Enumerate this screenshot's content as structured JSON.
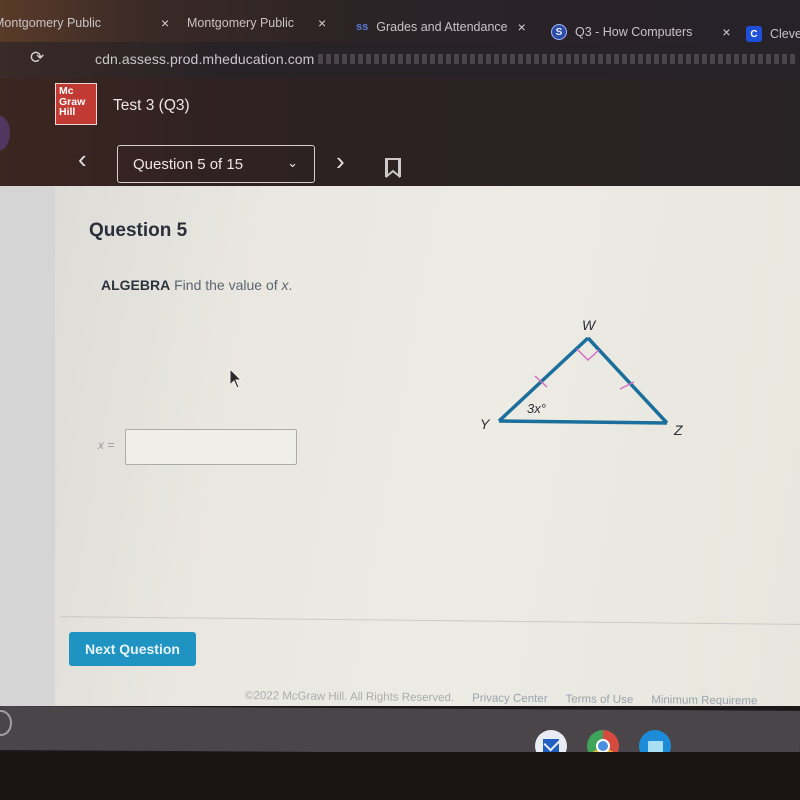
{
  "browser": {
    "tabs": [
      {
        "label": "Montgomery Public",
        "close": "×",
        "favicon": ""
      },
      {
        "label": "Montgomery Public",
        "close": "×",
        "favicon": ""
      },
      {
        "label": "Grades and Attendance",
        "close": "×",
        "favicon": "ss"
      },
      {
        "label": "Q3 - How Computers",
        "close": "×",
        "favicon": "S"
      },
      {
        "label": "Cleve",
        "close": "",
        "favicon": "C"
      }
    ],
    "url": "cdn.assess.prod.mheducation.com",
    "reload_icon": "⟳"
  },
  "header": {
    "logo_lines": [
      "Mc",
      "Graw",
      "Hill"
    ],
    "test_title": "Test 3 (Q3)",
    "question_selector": "Question 5 of 15",
    "prev_icon": "‹",
    "next_icon": "›",
    "chevron_icon": "⌄"
  },
  "question": {
    "heading": "Question 5",
    "subject": "ALGEBRA",
    "prompt": "Find the value of",
    "variable": "x",
    "answer_label": "x =",
    "answer_value": "",
    "figure": {
      "vertices": {
        "top": "W",
        "left": "Y",
        "right": "Z"
      },
      "angle_label": "3x°",
      "right_angle_at": "W",
      "congruent_sides": [
        "WY",
        "WZ"
      ],
      "line_color": "#1c6f9c",
      "mark_color": "#d46fc2"
    }
  },
  "actions": {
    "next_question": "Next Question"
  },
  "footer": {
    "copyright": "©2022 McGraw Hill. All Rights Reserved.",
    "links": [
      "Privacy Center",
      "Terms of Use",
      "Minimum Requireme"
    ]
  },
  "shelf": {
    "apps": [
      "gmail",
      "chrome",
      "files"
    ]
  }
}
